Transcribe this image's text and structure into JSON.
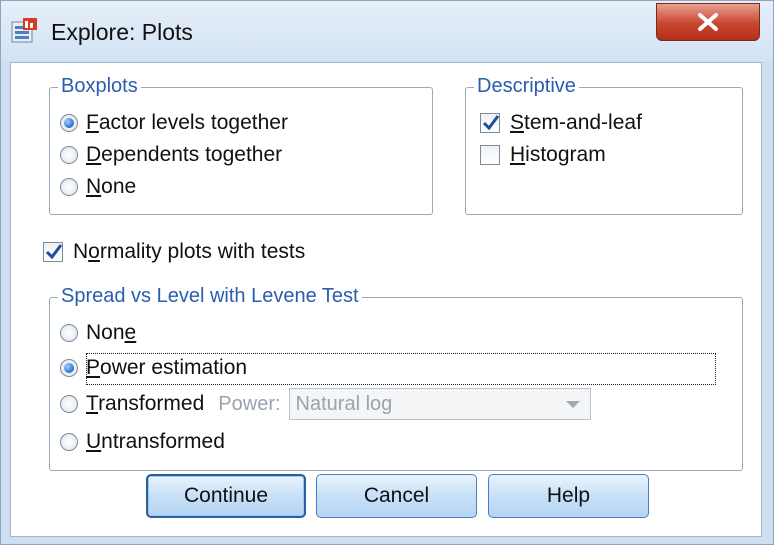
{
  "window": {
    "title": "Explore: Plots"
  },
  "boxplots": {
    "legend": "Boxplots",
    "options": [
      {
        "pre": "",
        "ul": "F",
        "post": "actor levels together",
        "selected": true
      },
      {
        "pre": "",
        "ul": "D",
        "post": "ependents together",
        "selected": false
      },
      {
        "pre": "",
        "ul": "N",
        "post": "one",
        "selected": false
      }
    ]
  },
  "descriptive": {
    "legend": "Descriptive",
    "options": [
      {
        "pre": "",
        "ul": "S",
        "post": "tem-and-leaf",
        "checked": true
      },
      {
        "pre": "",
        "ul": "H",
        "post": "istogram",
        "checked": false
      }
    ]
  },
  "normality": {
    "pre": "N",
    "ul": "o",
    "post": "rmality plots with tests",
    "checked": true
  },
  "spread": {
    "legend": "Spread vs Level with Levene Test",
    "options": [
      {
        "pre": "Non",
        "ul": "e",
        "post": "",
        "selected": false
      },
      {
        "pre": "",
        "ul": "P",
        "post": "ower estimation",
        "selected": true
      },
      {
        "pre": "",
        "ul": "T",
        "post": "ransformed",
        "selected": false
      },
      {
        "pre": "",
        "ul": "U",
        "post": "ntransformed",
        "selected": false
      }
    ],
    "power_label": {
      "pre": "Po",
      "ul": "w",
      "post": "er:"
    },
    "power_value": "Natural log"
  },
  "buttons": {
    "continue": "Continue",
    "cancel": "Cancel",
    "help": "Help"
  },
  "colors": {
    "accent": "#2a5db0",
    "title_bar": "#d3e2f3",
    "close": "#c8452e"
  }
}
